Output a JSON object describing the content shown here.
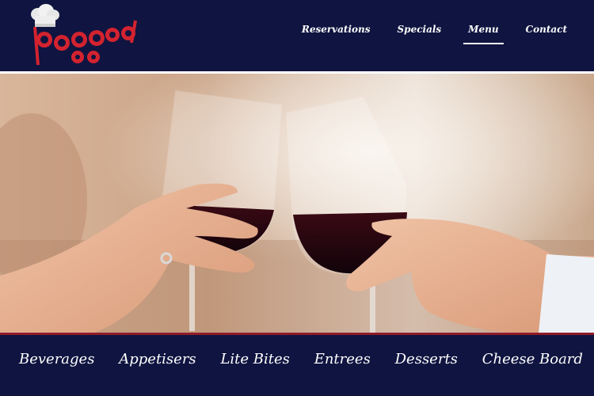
{
  "brand": {
    "logo_text": "pogged",
    "logo_color": "#d3232f",
    "logo_icon": "chef-hat-icon"
  },
  "nav": {
    "items": [
      {
        "label": "Reservations"
      },
      {
        "label": "Specials"
      },
      {
        "label": "Menu"
      },
      {
        "label": "Contact"
      }
    ],
    "active": "Menu"
  },
  "hero": {
    "image_subject": "two-wine-glasses-toast"
  },
  "categories": [
    {
      "label": "Beverages"
    },
    {
      "label": "Appetisers"
    },
    {
      "label": "Lite Bites"
    },
    {
      "label": "Entrees"
    },
    {
      "label": "Desserts"
    },
    {
      "label": "Cheese Board"
    }
  ],
  "colors": {
    "navy": "#0f1440",
    "accent_red": "#8e1b2b",
    "white": "#ffffff"
  }
}
